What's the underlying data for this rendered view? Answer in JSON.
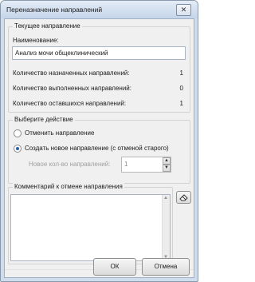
{
  "window": {
    "title": "Переназначение направлений",
    "close_glyph": "✕"
  },
  "current": {
    "group_title": "Текущее направление",
    "name_label": "Наименование:",
    "name_value": "Анализ мочи общеклинический",
    "assigned_label": "Количество назначенных направлений:",
    "assigned_value": "1",
    "completed_label": "Количество выполненных направлений:",
    "completed_value": "0",
    "remaining_label": "Количество оставшихся направлений:",
    "remaining_value": "1"
  },
  "action": {
    "group_title": "Выберите действие",
    "option_cancel": "Отменить направление",
    "option_create": "Создать новое направление (с отменой старого)",
    "selected": "option_create",
    "count_label": "Новое кол-во направлений:",
    "count_value": "1"
  },
  "comment": {
    "group_title": "Комментарий к отмене направления",
    "value": "",
    "eraser_icon": "eraser-icon"
  },
  "buttons": {
    "ok": "ОК",
    "cancel": "Отмена"
  }
}
